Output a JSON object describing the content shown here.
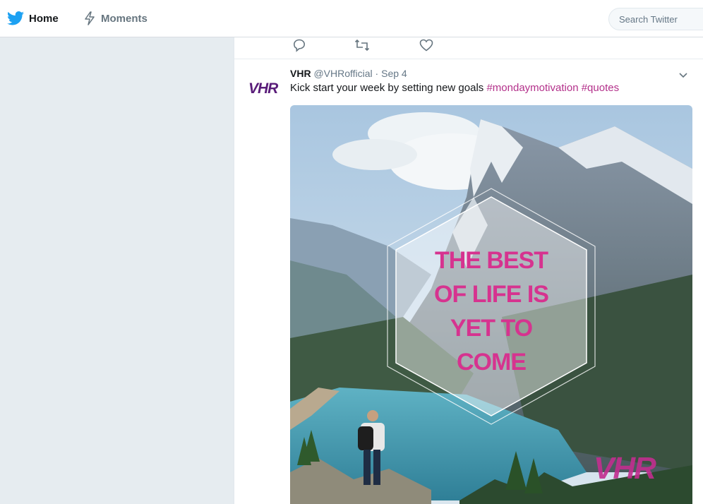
{
  "nav": {
    "home_label": "Home",
    "moments_label": "Moments",
    "search_placeholder": "Search Twitter"
  },
  "tweet": {
    "avatar_text": "VHR",
    "name": "VHR",
    "handle": "@VHRofficial",
    "separator": " · ",
    "date": "Sep 4",
    "text": "Kick start your week by setting new goals ",
    "hashtags": [
      "#mondaymotivation",
      "#quotes"
    ]
  },
  "media": {
    "quote_lines": [
      "THE BEST",
      "OF LIFE IS",
      "YET TO",
      "COME"
    ],
    "watermark": "VHR"
  },
  "icons": {
    "home": "twitter-bird-icon",
    "moments": "lightning-icon",
    "reply": "reply-icon",
    "retweet": "retweet-icon",
    "like": "heart-icon",
    "caret": "chevron-down-icon"
  },
  "colors": {
    "brand_blue": "#1da1f2",
    "hashtag": "#b3308a",
    "quote_text": "#d6338f",
    "avatar": "#5a1d7a"
  }
}
